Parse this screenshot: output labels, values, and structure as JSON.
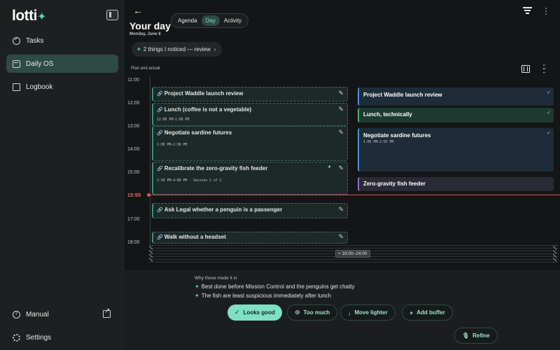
{
  "app": {
    "logo": "lotti",
    "logo_spark": "✦"
  },
  "sidebar": {
    "items": [
      {
        "label": "Tasks"
      },
      {
        "label": "Daily OS"
      },
      {
        "label": "Logbook"
      }
    ],
    "manual": "Manual",
    "settings": "Settings"
  },
  "header": {
    "title": "Your day",
    "date": "Monday, June 8",
    "tabs": [
      "Agenda",
      "Day",
      "Activity"
    ],
    "active_tab": "Day"
  },
  "notice": {
    "label": "2 things I noticed — review",
    "chevron": "›"
  },
  "section_label": "Plan and actual",
  "timeline": {
    "hours": [
      "11:00",
      "12:00",
      "13:00",
      "14:00",
      "15:00",
      "17:00",
      "18:00"
    ],
    "now": "15:55",
    "collapsed_range": "≈ 18:00–24:00"
  },
  "plan": [
    {
      "title": "Project Waddle launch review",
      "sub": ""
    },
    {
      "title": "Lunch (coffee is not a vegetable)",
      "sub": "12:00 PM–1:00 PM"
    },
    {
      "title": "Negotiate sardine futures",
      "sub": "1:00 PM–2:30 PM"
    },
    {
      "title": "Recalibrate the zero-gravity fish feeder",
      "sub": "2:30 PM–4:00 PM · Session 1 of 2"
    },
    {
      "title": "Ask Legal whether a penguin is a passenger",
      "sub": ""
    },
    {
      "title": "Walk without a headset",
      "sub": ""
    }
  ],
  "actual": [
    {
      "title": "Project Waddle launch review",
      "sub": "",
      "check": "✓"
    },
    {
      "title": "Lunch, technically",
      "sub": "",
      "check": "✓"
    },
    {
      "title": "Negotiate sardine futures",
      "sub": "1:05 PM–2:55 PM",
      "check": "✓"
    },
    {
      "title": "Zero-gravity fish feeder",
      "sub": "",
      "check": ""
    }
  ],
  "why": {
    "heading": "Why these made it in",
    "reasons": [
      "Best done before Mission Control and the penguins get chatty",
      "The fish are least suspicious immediately after lunch"
    ]
  },
  "actions": {
    "looks_good": "Looks good",
    "too_much": "Too much",
    "move_lighter": "Move lighter",
    "add_buffer": "Add buffer",
    "refine": "Refine"
  },
  "colors": {
    "accent": "#7fe0c2",
    "now_line": "#d85555",
    "sidebar_active": "#2e4a44",
    "card_blue": "#4b8fd8",
    "card_green": "#45b06f",
    "card_purple": "#8e6ad6"
  }
}
